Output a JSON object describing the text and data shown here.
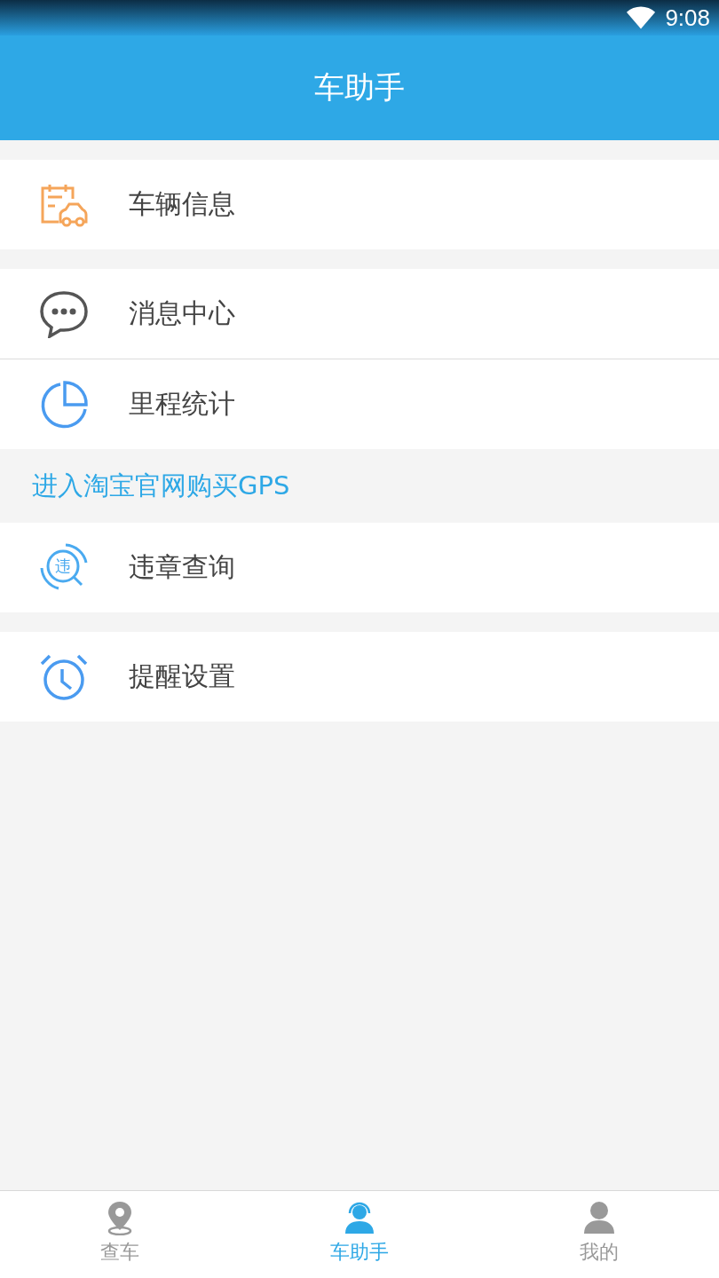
{
  "status_bar": {
    "time": "9:08"
  },
  "header": {
    "title": "车助手"
  },
  "sections": [
    {
      "kind": "group",
      "items": [
        {
          "kind": "car-document",
          "label": "车辆信息"
        }
      ]
    },
    {
      "kind": "group",
      "items": [
        {
          "kind": "chat",
          "label": "消息中心"
        },
        {
          "kind": "pie",
          "label": "里程统计"
        }
      ]
    },
    {
      "kind": "link",
      "text": "进入淘宝官网购买GPS"
    },
    {
      "kind": "group",
      "items": [
        {
          "kind": "violation",
          "icon_text": "违",
          "label": "违章查询"
        }
      ]
    },
    {
      "kind": "group",
      "items": [
        {
          "kind": "alarm",
          "label": "提醒设置"
        }
      ]
    }
  ],
  "tabs": [
    {
      "kind": "pin",
      "label": "查车",
      "selected": false
    },
    {
      "kind": "agent",
      "label": "车助手",
      "selected": true
    },
    {
      "kind": "person",
      "label": "我的",
      "selected": false
    }
  ]
}
